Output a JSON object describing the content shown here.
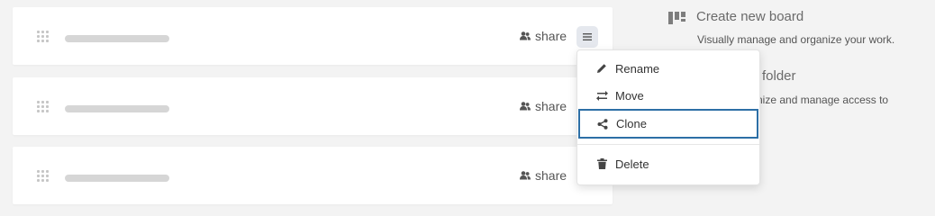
{
  "boards": [
    {
      "share_label": "share"
    },
    {
      "share_label": "share"
    },
    {
      "share_label": "share"
    }
  ],
  "side": {
    "create_board": {
      "title": "Create new board",
      "description": "Visually manage and organize your work."
    },
    "create_folder": {
      "title": "w folder",
      "description": "nize and manage access to"
    }
  },
  "context_menu": {
    "items": [
      {
        "label": "Rename",
        "icon": "pencil-icon"
      },
      {
        "label": "Move",
        "icon": "move-arrows-icon"
      },
      {
        "label": "Clone",
        "icon": "share-nodes-icon",
        "highlighted": true
      },
      {
        "label": "Delete",
        "icon": "trash-icon"
      }
    ]
  },
  "colors": {
    "highlight_border": "#2d6fa6",
    "menu_button_bg": "#e5e8ee",
    "placeholder_bar": "#d6d6d6"
  }
}
